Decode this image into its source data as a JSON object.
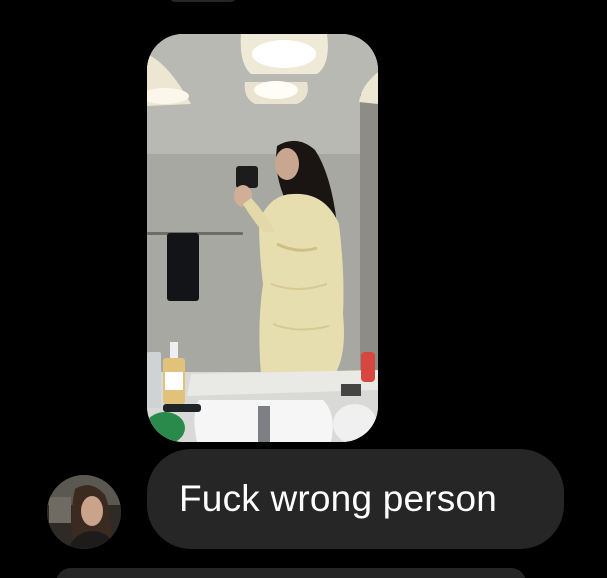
{
  "thread": {
    "messages": [
      {
        "type": "photo",
        "alt": "mirror selfie photo message"
      },
      {
        "type": "text",
        "text": "Fuck wrong person"
      }
    ]
  },
  "colors": {
    "background": "#000000",
    "bubble": "#262626",
    "text": "#ffffff"
  },
  "icons": {
    "avatar": "contact-avatar"
  }
}
